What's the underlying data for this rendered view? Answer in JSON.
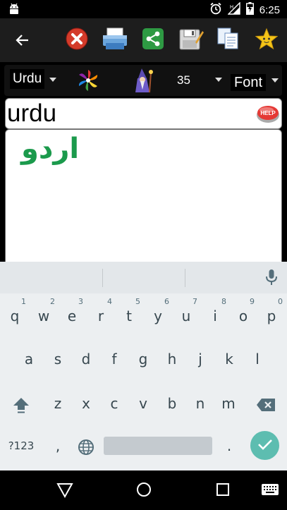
{
  "status_bar": {
    "time": "6:25",
    "icons": [
      "android-icon",
      "alarm-icon",
      "signal-icon",
      "battery-icon"
    ]
  },
  "toolbar": {
    "buttons": [
      "back-arrow-icon",
      "close-icon",
      "print-icon",
      "share-icon",
      "save-icon",
      "copy-icon",
      "star-icon"
    ]
  },
  "options": {
    "language": "Urdu",
    "font_size": "35",
    "font_label": "Font"
  },
  "input": {
    "value": "urdu",
    "help_label": "HELP"
  },
  "output": {
    "text": "اردو",
    "text_color": "#1b9a4c"
  },
  "keyboard": {
    "row1": [
      {
        "key": "q",
        "hint": "1"
      },
      {
        "key": "w",
        "hint": "2"
      },
      {
        "key": "e",
        "hint": "3"
      },
      {
        "key": "r",
        "hint": "4"
      },
      {
        "key": "t",
        "hint": "5"
      },
      {
        "key": "y",
        "hint": "6"
      },
      {
        "key": "u",
        "hint": "7"
      },
      {
        "key": "i",
        "hint": "8"
      },
      {
        "key": "o",
        "hint": "9"
      },
      {
        "key": "p",
        "hint": "0"
      }
    ],
    "row2": [
      "a",
      "s",
      "d",
      "f",
      "g",
      "h",
      "j",
      "k",
      "l"
    ],
    "row3": [
      "z",
      "x",
      "c",
      "v",
      "b",
      "n",
      "m"
    ],
    "symbols_label": "?123",
    "comma": ",",
    "period": ".",
    "accent_color": "#5dbdb0"
  },
  "nav": {
    "icons": [
      "back-triangle-icon",
      "home-circle-icon",
      "recents-square-icon",
      "keyboard-icon"
    ]
  }
}
